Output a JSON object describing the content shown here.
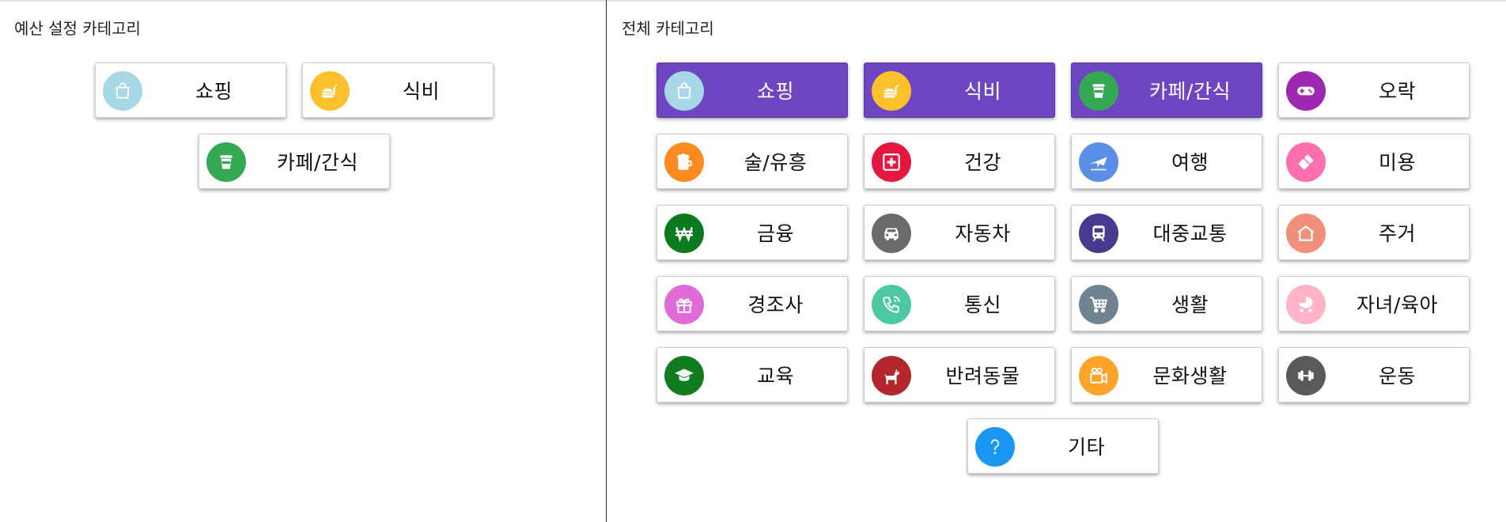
{
  "left_panel": {
    "title": "예산 설정 카테고리",
    "items": [
      {
        "label": "쇼핑",
        "icon": "shopping-bag-icon",
        "color": "#a8d8e8"
      },
      {
        "label": "식비",
        "icon": "food-icon",
        "color": "#fbc12d"
      },
      {
        "label": "카페/간식",
        "icon": "cafe-cup-icon",
        "color": "#34a853"
      }
    ]
  },
  "right_panel": {
    "title": "전체 카테고리",
    "items": [
      {
        "label": "쇼핑",
        "icon": "shopping-bag-icon",
        "color": "#a8d8e8",
        "selected": true
      },
      {
        "label": "식비",
        "icon": "food-icon",
        "color": "#fbc12d",
        "selected": true
      },
      {
        "label": "카페/간식",
        "icon": "cafe-cup-icon",
        "color": "#34a853",
        "selected": true
      },
      {
        "label": "오락",
        "icon": "gamepad-icon",
        "color": "#9c27b0",
        "selected": false
      },
      {
        "label": "술/유흥",
        "icon": "beer-icon",
        "color": "#ff8a1f",
        "selected": false
      },
      {
        "label": "건강",
        "icon": "medical-cross-icon",
        "color": "#e5173f",
        "selected": false
      },
      {
        "label": "여행",
        "icon": "airplane-icon",
        "color": "#5b8fe6",
        "selected": false
      },
      {
        "label": "미용",
        "icon": "lipstick-icon",
        "color": "#ff6fb0",
        "selected": false
      },
      {
        "label": "금융",
        "icon": "won-icon",
        "color": "#0b7a1e",
        "selected": false
      },
      {
        "label": "자동차",
        "icon": "car-icon",
        "color": "#6b6b6b",
        "selected": false
      },
      {
        "label": "대중교통",
        "icon": "train-icon",
        "color": "#4a3a8f",
        "selected": false
      },
      {
        "label": "주거",
        "icon": "home-icon",
        "color": "#f0907a",
        "selected": false
      },
      {
        "label": "경조사",
        "icon": "gift-icon",
        "color": "#e06ad6",
        "selected": false
      },
      {
        "label": "통신",
        "icon": "phone-icon",
        "color": "#4cc9a4",
        "selected": false
      },
      {
        "label": "생활",
        "icon": "cart-icon",
        "color": "#6f8391",
        "selected": false
      },
      {
        "label": "자녀/육아",
        "icon": "stroller-icon",
        "color": "#ffb3c6",
        "selected": false
      },
      {
        "label": "교육",
        "icon": "graduation-cap-icon",
        "color": "#0e7c1f",
        "selected": false
      },
      {
        "label": "반려동물",
        "icon": "dog-icon",
        "color": "#b3262c",
        "selected": false
      },
      {
        "label": "문화생활",
        "icon": "film-camera-icon",
        "color": "#ffa42a",
        "selected": false
      },
      {
        "label": "운동",
        "icon": "dumbbell-icon",
        "color": "#5a5a5a",
        "selected": false
      },
      {
        "label": "기타",
        "icon": "question-icon",
        "color": "#1a96f5",
        "selected": false
      }
    ]
  }
}
